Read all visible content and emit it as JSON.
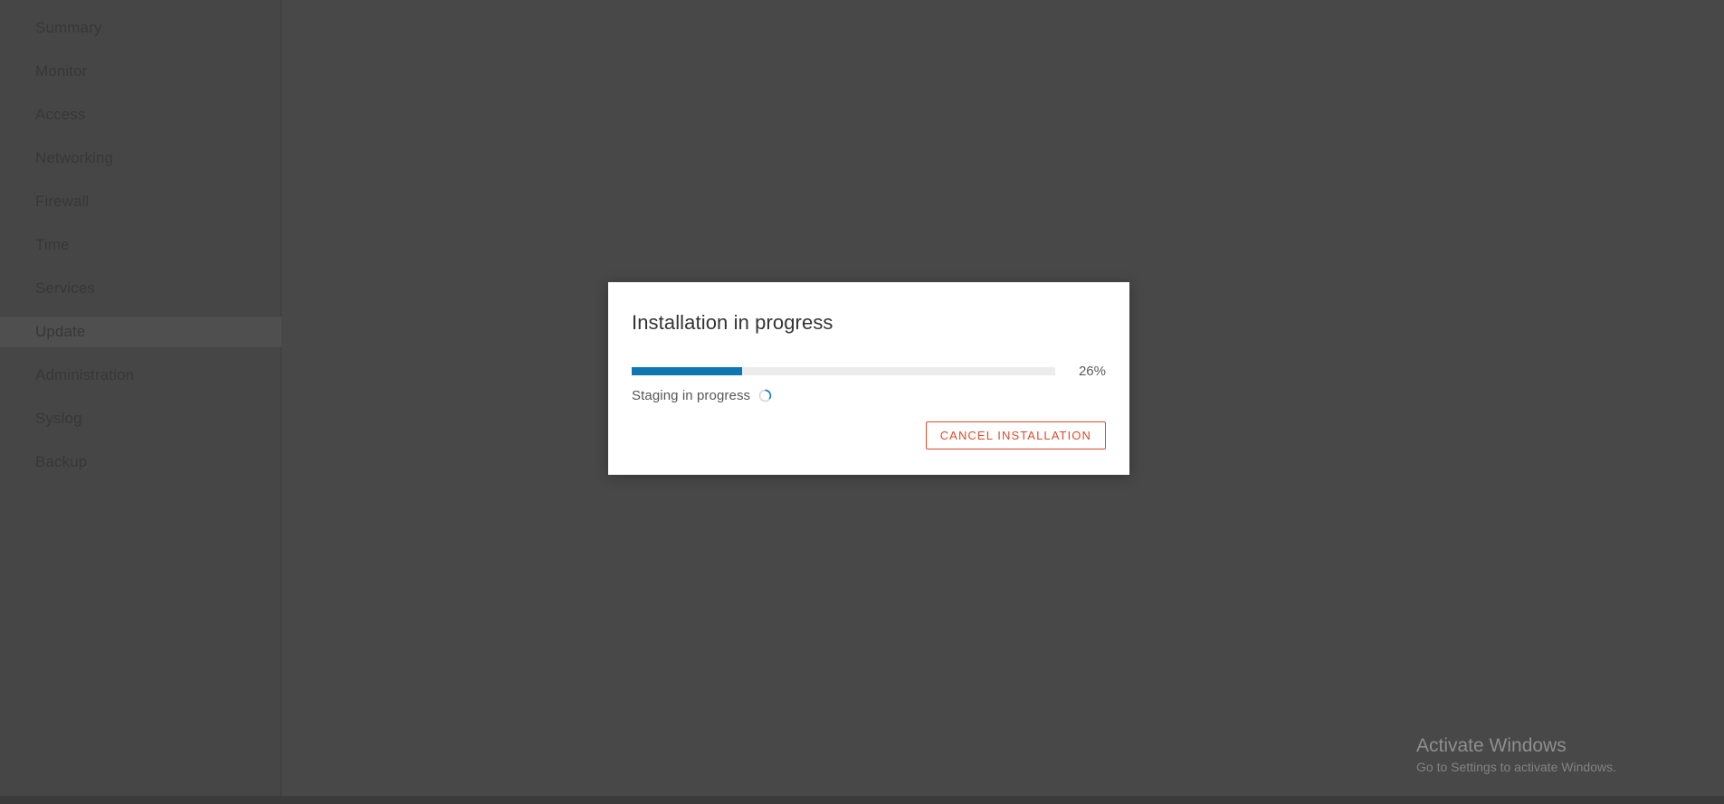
{
  "colors": {
    "overlay_background": "#4e4e4e",
    "sidebar_background": "#4c4c4c",
    "sidebar_selected": "#565656",
    "nav_text": "#3b3b3b",
    "dialog_background": "#ffffff",
    "progress_fill": "#0f76b4",
    "progress_track": "#ececec",
    "danger_accent": "#dd4b28",
    "title_text": "#333333"
  },
  "sidebar": {
    "items": [
      {
        "label": "Summary",
        "selected": false
      },
      {
        "label": "Monitor",
        "selected": false
      },
      {
        "label": "Access",
        "selected": false
      },
      {
        "label": "Networking",
        "selected": false
      },
      {
        "label": "Firewall",
        "selected": false
      },
      {
        "label": "Time",
        "selected": false
      },
      {
        "label": "Services",
        "selected": false
      },
      {
        "label": "Update",
        "selected": true
      },
      {
        "label": "Administration",
        "selected": false
      },
      {
        "label": "Syslog",
        "selected": false
      },
      {
        "label": "Backup",
        "selected": false
      }
    ]
  },
  "dialog": {
    "title": "Installation in progress",
    "progress": {
      "percent_value": 26,
      "percent_label": "26%",
      "spinner_icon": "loading-spinner-icon"
    },
    "status_text": "Staging in progress",
    "cancel_label": "CANCEL INSTALLATION"
  },
  "watermark": {
    "title": "Activate Windows",
    "subtitle": "Go to Settings to activate Windows."
  }
}
